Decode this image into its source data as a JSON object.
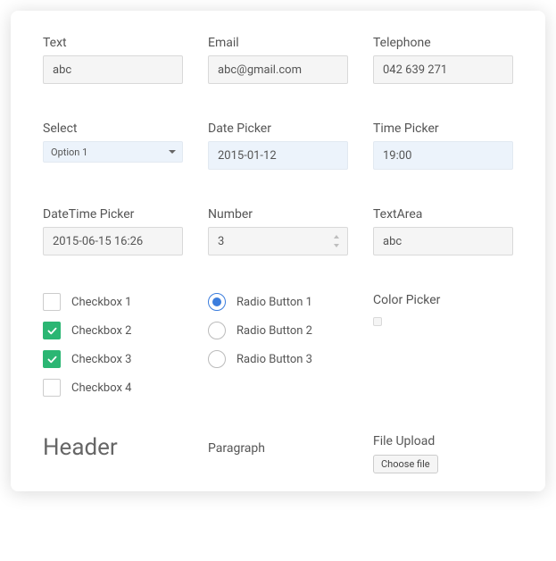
{
  "fields": {
    "text": {
      "label": "Text",
      "value": "abc"
    },
    "email": {
      "label": "Email",
      "value": "abc@gmail.com"
    },
    "telephone": {
      "label": "Telephone",
      "value": "042 639 271"
    },
    "select": {
      "label": "Select",
      "value": "Option 1"
    },
    "datePicker": {
      "label": "Date Picker",
      "value": "2015-01-12"
    },
    "timePicker": {
      "label": "Time Picker",
      "value": "19:00"
    },
    "dateTime": {
      "label": "DateTime Picker",
      "value": "2015-06-15 16:26"
    },
    "number": {
      "label": "Number",
      "value": "3"
    },
    "textarea": {
      "label": "TextArea",
      "value": "abc"
    },
    "colorPicker": {
      "label": "Color Picker",
      "value": "#555049"
    },
    "fileUpload": {
      "label": "File Upload",
      "button": "Choose file"
    }
  },
  "checkboxes": {
    "items": [
      {
        "label": "Checkbox 1",
        "checked": false
      },
      {
        "label": "Checkbox 2",
        "checked": true
      },
      {
        "label": "Checkbox 3",
        "checked": true
      },
      {
        "label": "Checkbox 4",
        "checked": false
      }
    ]
  },
  "radios": {
    "items": [
      {
        "label": "Radio Button 1",
        "selected": true
      },
      {
        "label": "Radio Button 2",
        "selected": false
      },
      {
        "label": "Radio Button 3",
        "selected": false
      }
    ]
  },
  "header": "Header",
  "paragraph": "Paragraph"
}
